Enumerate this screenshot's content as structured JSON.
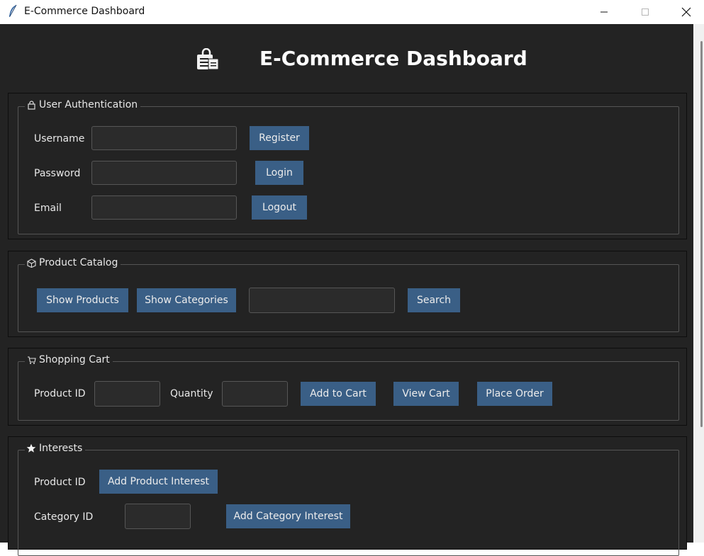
{
  "window": {
    "title": "E-Commerce Dashboard"
  },
  "header": {
    "title": "E-Commerce Dashboard",
    "icon": "clipboard-lock-icon"
  },
  "auth": {
    "legend": "User Authentication",
    "username_label": "Username",
    "password_label": "Password",
    "email_label": "Email",
    "username_value": "",
    "password_value": "",
    "email_value": "",
    "register_label": "Register",
    "login_label": "Login",
    "logout_label": "Logout"
  },
  "catalog": {
    "legend": "Product Catalog",
    "show_products_label": "Show Products",
    "show_categories_label": "Show Categories",
    "search_value": "",
    "search_label": "Search"
  },
  "cart": {
    "legend": "Shopping Cart",
    "product_id_label": "Product ID",
    "quantity_label": "Quantity",
    "product_id_value": "",
    "quantity_value": "",
    "add_to_cart_label": "Add to Cart",
    "view_cart_label": "View Cart",
    "place_order_label": "Place Order"
  },
  "interests": {
    "legend": "Interests",
    "product_id_label": "Product ID",
    "add_product_interest_label": "Add Product Interest",
    "category_id_label": "Category ID",
    "category_id_value": "",
    "add_category_interest_label": "Add Category Interest"
  },
  "colors": {
    "background": "#232323",
    "button": "#3a5f86",
    "entry": "#2b2b2b",
    "text": "#e8e8e8"
  }
}
